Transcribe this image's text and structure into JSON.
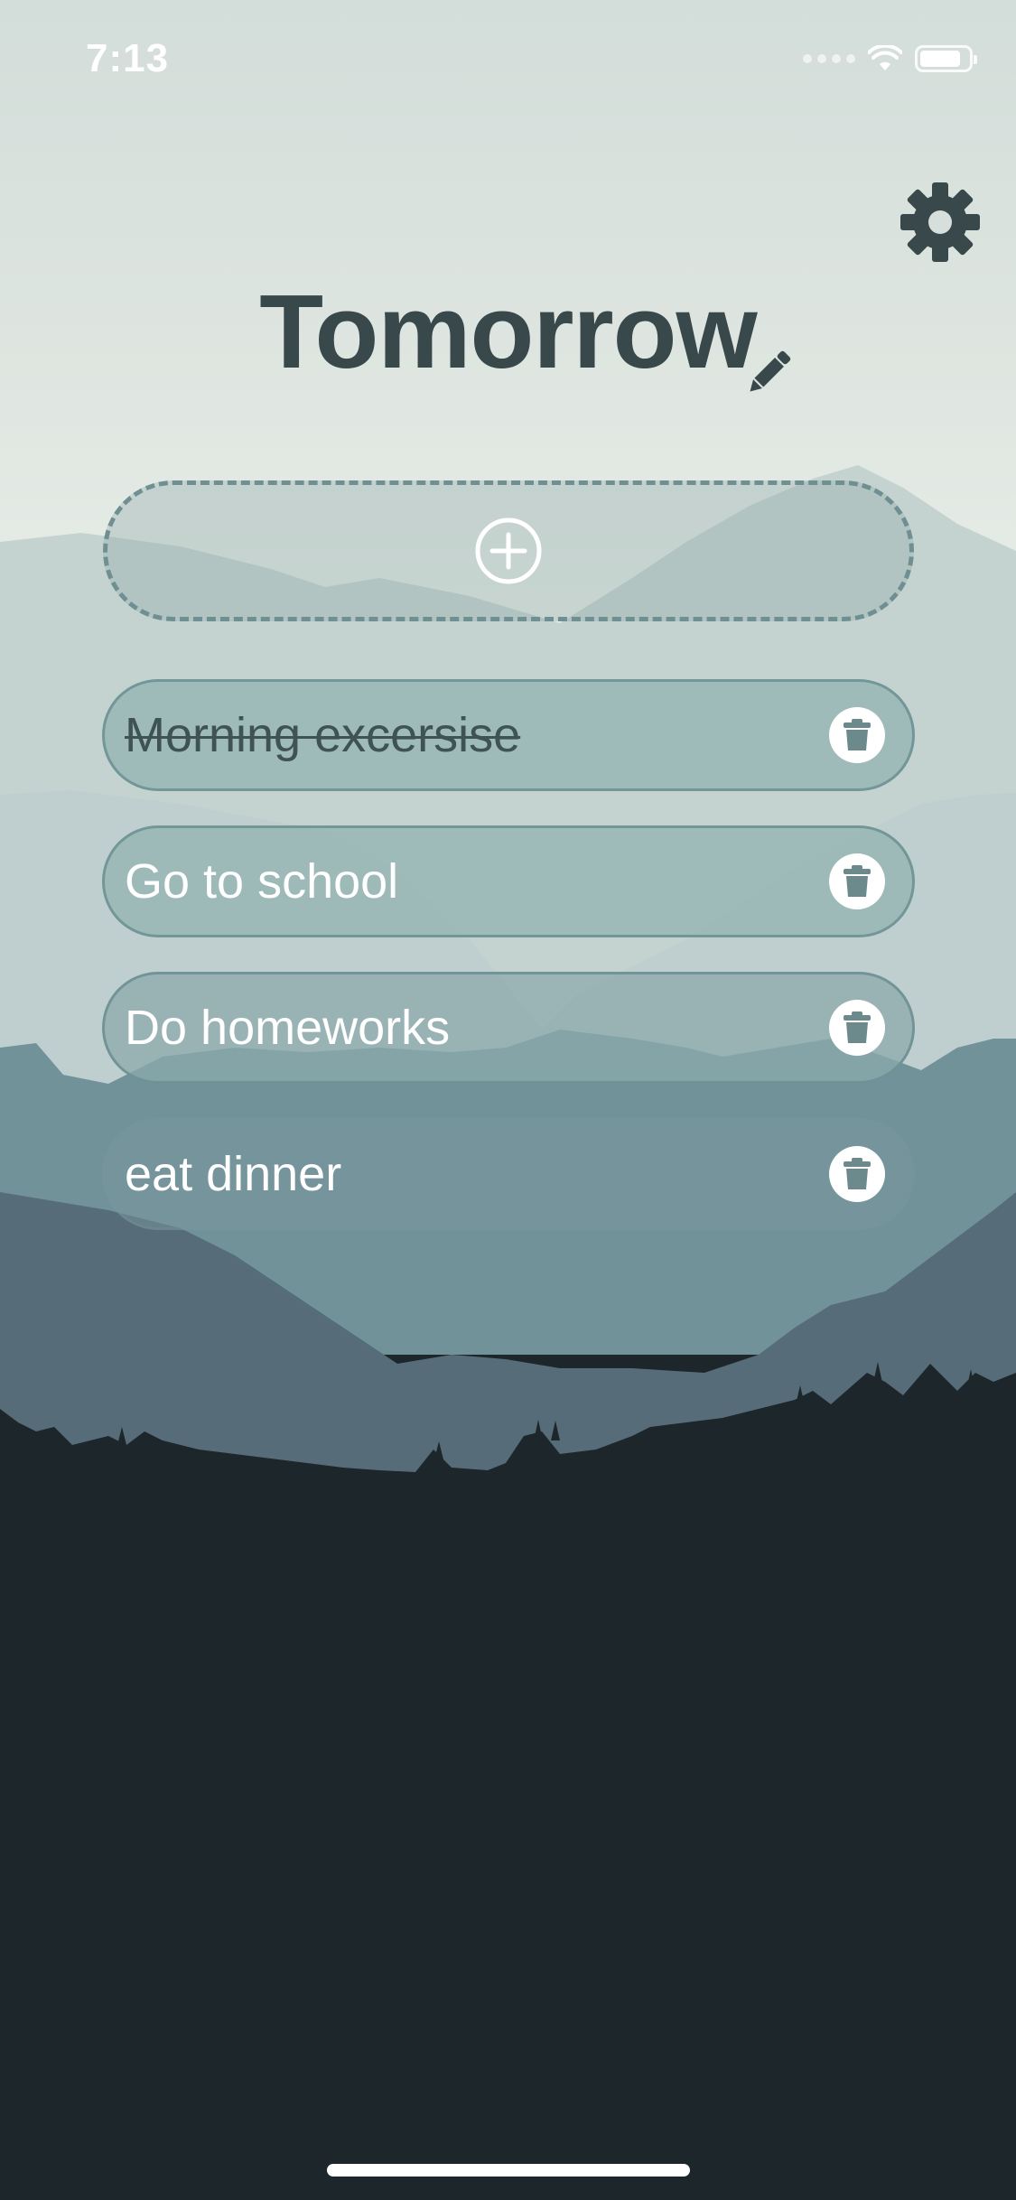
{
  "status_bar": {
    "time": "7:13",
    "battery_level": 0.85
  },
  "header": {
    "title": "Tomorrow"
  },
  "icons": {
    "settings": "gear-icon",
    "edit": "pencil-icon",
    "add": "plus-circle-icon",
    "delete": "trash-icon"
  },
  "tasks": [
    {
      "label": "Morning excersise",
      "completed": true
    },
    {
      "label": "Go to school",
      "completed": false
    },
    {
      "label": "Do homeworks",
      "completed": false
    },
    {
      "label": "eat dinner",
      "completed": false
    }
  ],
  "colors": {
    "title": "#39484b",
    "sky_top": "#d3ddd9",
    "forest": "#1c262b",
    "task_bg": "#9ab8b7",
    "dashed_border": "#6f8f93"
  }
}
